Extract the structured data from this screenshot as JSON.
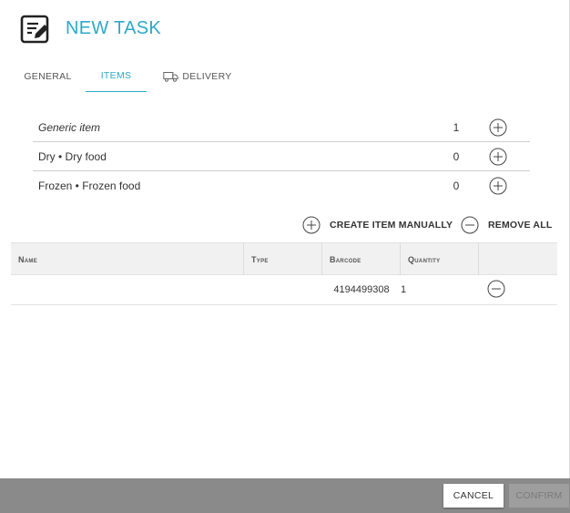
{
  "header": {
    "title": "NEW TASK",
    "icon": "edit-note-icon"
  },
  "tabs": [
    {
      "label": "GENERAL",
      "active": false
    },
    {
      "label": "ITEMS",
      "active": true
    },
    {
      "label": "DELIVERY",
      "active": false,
      "icon": "truck-icon"
    }
  ],
  "catalog": [
    {
      "name": "Generic item",
      "quantity": "1",
      "icon": "add-circle-icon"
    },
    {
      "name": "Dry • Dry food",
      "quantity": "0",
      "icon": "add-circle-icon"
    },
    {
      "name": "Frozen • Frozen food",
      "quantity": "0",
      "icon": "add-circle-icon"
    }
  ],
  "actions": {
    "create_label": "CREATE ITEM MANUALLY",
    "remove_label": "REMOVE ALL"
  },
  "table": {
    "columns": [
      "Name",
      "Type",
      "Barcode",
      "Quantity",
      ""
    ],
    "rows": [
      {
        "name": "",
        "type": "",
        "barcode": "4194499308",
        "quantity": "1"
      }
    ]
  },
  "footer": {
    "cancel_label": "CANCEL",
    "confirm_label": "CONFIRM"
  },
  "colors": {
    "accent": "#2fa8c8",
    "footer_bg": "#8a8a8a",
    "header_bg": "#f1f1f1"
  }
}
